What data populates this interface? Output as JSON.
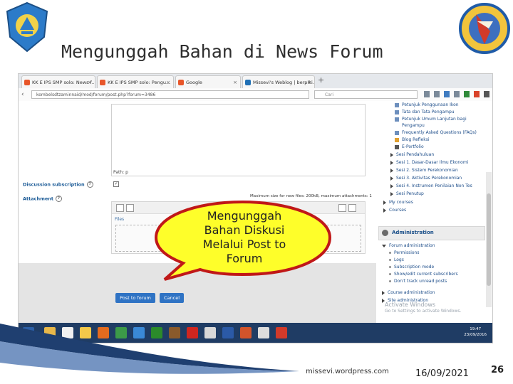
{
  "slide": {
    "title": "Mengunggah Bahan di News Forum",
    "callout_text": "Mengunggah Bahan Diskusi Melalui Post to Forum",
    "footer_site": "missevi.wordpress.com",
    "footer_date": "16/09/2021",
    "page_number": "26"
  },
  "browser": {
    "tabs": [
      {
        "label": "KK E IPS SMP solo: News f...",
        "favicon_color": "#e8562a"
      },
      {
        "label": "KK E IPS SMP solo: Pengu...",
        "favicon_color": "#e8562a"
      },
      {
        "label": "Google",
        "favicon_color": "#e8562a"
      },
      {
        "label": "Missevi's Weblog | berpiki...",
        "favicon_color": "#1f6fb5"
      }
    ],
    "new_tab": "+",
    "url": "kombelsdtzaminnaid/mod/forum/post.php?forum=3486",
    "search_placeholder": "Cari"
  },
  "form": {
    "editor_path": "Path: p",
    "discussion_label": "Discussion subscription",
    "attachment_label": "Attachment",
    "max_size": "Maximum size for new files: 200kB, maximum attachments: 1",
    "files_crumb": "Files",
    "post_button": "Post to forum",
    "cancel_button": "Cancel",
    "discussion_checked": true
  },
  "sidebar": {
    "items": [
      "Petunjuk Penggunaan Ikon",
      "Tata dan Tata Pengampu",
      "Petunjuk Umum Lanjutan bagi",
      "Pengampu",
      "Frequently Asked Questions (FAQs)",
      "Blog Refleksi",
      "E-Portfolio",
      "Sesi Pendahuluan",
      "Sesi 1. Dasar-Dasar Ilmu Ekonomi",
      "Sesi 2. Sistem Perekonomian",
      "Sesi 3. Aktivitas Perekonomian",
      "Sesi 4. Instrumen Penilaian Non Tes",
      "Sesi Penutup",
      "My courses",
      "Courses"
    ],
    "admin_title": "Administration",
    "admin_items": [
      "Forum administration",
      "Permissions",
      "Logs",
      "Subscription mode",
      "Show/edit current subscribers",
      "Don't track unread posts",
      "Course administration",
      "Site administration"
    ],
    "activate_line1": "Activate Windows",
    "activate_line2": "Go to Settings to activate Windows."
  },
  "taskbar": {
    "time": "19:47",
    "date": "23/09/2016",
    "apps": [
      {
        "name": "folder",
        "color": "#e8b84a"
      },
      {
        "name": "media",
        "color": "#f0f0f0"
      },
      {
        "name": "explorer",
        "color": "#f2c84a"
      },
      {
        "name": "firefox",
        "color": "#e26b1f"
      },
      {
        "name": "chrome",
        "color": "#3c9a48"
      },
      {
        "name": "ie",
        "color": "#3a89d6"
      },
      {
        "name": "notes",
        "color": "#2b8b2b"
      },
      {
        "name": "pictures",
        "color": "#8a5a2b"
      },
      {
        "name": "pdf",
        "color": "#d0261f"
      },
      {
        "name": "snip",
        "color": "#d8d8d8"
      },
      {
        "name": "word",
        "color": "#2b5aa7"
      },
      {
        "name": "powerpoint",
        "color": "#d2542b"
      },
      {
        "name": "paint",
        "color": "#dddddd"
      },
      {
        "name": "other",
        "color": "#d23a2a"
      }
    ]
  },
  "colors": {
    "callout_fill": "#fefe2a",
    "callout_border": "#c01818",
    "post_button": "#2f73c4",
    "cancel_button": "#2f73c4"
  }
}
